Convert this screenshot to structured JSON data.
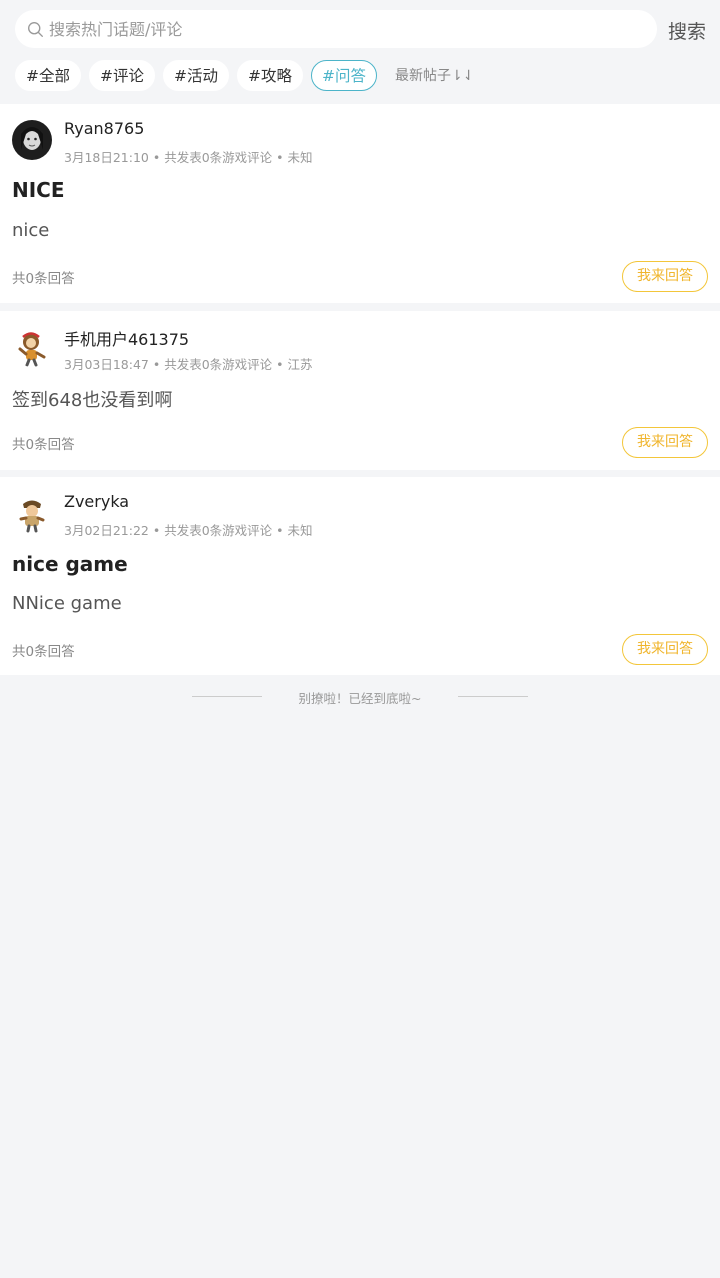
{
  "search": {
    "placeholder": "搜索热门话题/评论",
    "button": "搜索"
  },
  "tags": [
    {
      "label": "#全部",
      "active": false
    },
    {
      "label": "#评论",
      "active": false
    },
    {
      "label": "#活动",
      "active": false
    },
    {
      "label": "#攻略",
      "active": false
    },
    {
      "label": "#问答",
      "active": true
    }
  ],
  "sort_label": "最新帖子⇂⇃",
  "posts": [
    {
      "user": "Ryan8765",
      "meta": "3月18日21:10 • 共发表0条游戏评论 • 未知",
      "title": "NICE",
      "body": "nice",
      "count": "共0条回答",
      "answer": "我来回答",
      "avatar": "dark-portrait-avatar"
    },
    {
      "user": "手机用户461375",
      "meta": "3月03日18:47 • 共发表0条游戏评论 • 江苏",
      "title": "",
      "body": "签到648也没看到啊",
      "count": "共0条回答",
      "answer": "我来回答",
      "avatar": "cartoon-monkey-avatar"
    },
    {
      "user": "Zveryka",
      "meta": "3月02日21:22 • 共发表0条游戏评论 • 未知",
      "title": "nice game",
      "body": "NNice game",
      "count": "共0条回答",
      "answer": "我来回答",
      "avatar": "cartoon-character-avatar"
    }
  ],
  "footer": "别撩啦！已经到底啦~",
  "colors": {
    "accent_teal": "#4cb4c9",
    "answer_yellow": "#f0b52c",
    "background": "#f4f5f7"
  }
}
